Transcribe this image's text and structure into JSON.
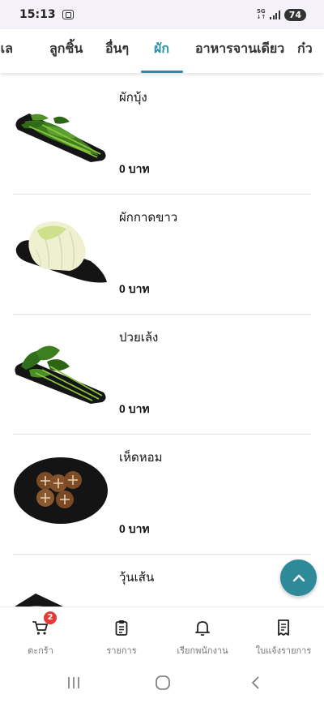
{
  "status_bar": {
    "time": "15:13",
    "network": "5G",
    "battery": "74"
  },
  "tabs": [
    {
      "label": "ะเล",
      "active": false
    },
    {
      "label": "ลูกชิ้น",
      "active": false
    },
    {
      "label": "อื่นๆ",
      "active": false
    },
    {
      "label": "ผัก",
      "active": true
    },
    {
      "label": "อาหารจานเดียว",
      "active": false
    },
    {
      "label": "ก๋ว",
      "active": false
    }
  ],
  "items": [
    {
      "name": "ผักบุ้ง",
      "price": "0 บาท",
      "image": "morning-glory-dish"
    },
    {
      "name": "ผักกาดขาว",
      "price": "0 บาท",
      "image": "napa-cabbage-dish"
    },
    {
      "name": "ปวยเล้ง",
      "price": "0 บาท",
      "image": "spinach-dish"
    },
    {
      "name": "เห็ดหอม",
      "price": "0 บาท",
      "image": "shiitake-mushroom-dish"
    },
    {
      "name": "วุ้นเส้น",
      "price": "",
      "image": "glass-noodle-dish"
    }
  ],
  "bottom_nav": {
    "cart": {
      "label": "ตะกร้า",
      "badge": "2",
      "icon": "cart-icon"
    },
    "orders": {
      "label": "รายการ",
      "icon": "clipboard-icon"
    },
    "call_staff": {
      "label": "เรียกพนักงาน",
      "icon": "bell-icon"
    },
    "receipt": {
      "label": "ใบแจ้งรายการ",
      "icon": "receipt-icon"
    }
  },
  "colors": {
    "accent": "#2a8fa0",
    "fab": "#2e8a99",
    "badge": "#e53935"
  }
}
